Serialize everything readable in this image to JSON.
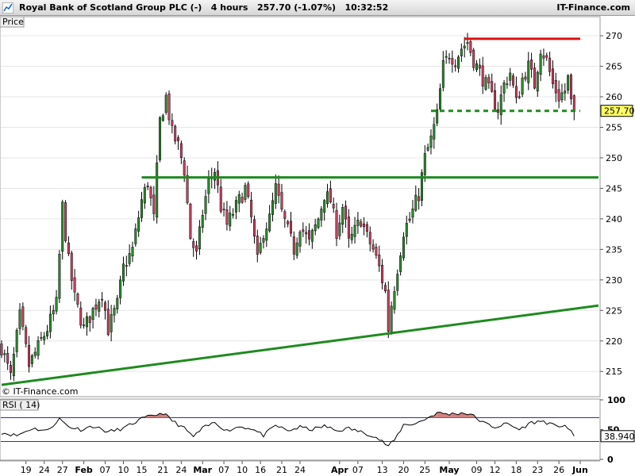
{
  "header": {
    "title": "Royal Bank of Scotland Group PLC (-)   4 hours   257.70 (-1.07%)   10:32:52",
    "brand": "IT-Finance.com"
  },
  "colors": {
    "up": "#2e8b2e",
    "down": "#c94060",
    "support": "#1f8a1f",
    "resistance": "#e01010",
    "rsi_line": "#000000",
    "rsi_levels": "#3030a0",
    "rsi_fill": "#d08080"
  },
  "price_panel": {
    "label": "Price",
    "watermark": "© IT-Finance.com",
    "last_value": "257.70"
  },
  "rsi_panel": {
    "label": "RSI ( 14)",
    "last_value": "38.940"
  },
  "chart_data": [
    {
      "type": "candlestick",
      "ylim": [
        211,
        273
      ],
      "yticks": [
        215,
        220,
        225,
        230,
        235,
        240,
        245,
        250,
        255,
        260,
        265,
        270
      ],
      "x_range": [
        0,
        196
      ],
      "xticks": [
        {
          "label": "19",
          "x": 8,
          "bold": false
        },
        {
          "label": "24",
          "x": 14,
          "bold": false
        },
        {
          "label": "27",
          "x": 20,
          "bold": false
        },
        {
          "label": "Feb",
          "x": 27,
          "bold": true
        },
        {
          "label": "07",
          "x": 34,
          "bold": false
        },
        {
          "label": "10",
          "x": 40,
          "bold": false
        },
        {
          "label": "15",
          "x": 46,
          "bold": false
        },
        {
          "label": "21",
          "x": 53,
          "bold": false
        },
        {
          "label": "24",
          "x": 59,
          "bold": false
        },
        {
          "label": "Mar",
          "x": 66,
          "bold": true
        },
        {
          "label": "07",
          "x": 73,
          "bold": false
        },
        {
          "label": "10",
          "x": 79,
          "bold": false
        },
        {
          "label": "16",
          "x": 85,
          "bold": false
        },
        {
          "label": "21",
          "x": 92,
          "bold": false
        },
        {
          "label": "24",
          "x": 98,
          "bold": false
        },
        {
          "label": "Apr",
          "x": 111,
          "bold": true
        },
        {
          "label": "07",
          "x": 117,
          "bold": false
        },
        {
          "label": "13",
          "x": 125,
          "bold": false
        },
        {
          "label": "20",
          "x": 132,
          "bold": false
        },
        {
          "label": "25",
          "x": 139,
          "bold": false
        },
        {
          "label": "May",
          "x": 147,
          "bold": true
        },
        {
          "label": "09",
          "x": 156,
          "bold": false
        },
        {
          "label": "12",
          "x": 162,
          "bold": false
        },
        {
          "label": "18",
          "x": 169,
          "bold": false
        },
        {
          "label": "23",
          "x": 176,
          "bold": false
        },
        {
          "label": "26",
          "x": 183,
          "bold": false
        },
        {
          "label": "Jun",
          "x": 190,
          "bold": true
        }
      ],
      "key_points": [
        {
          "x": 0,
          "v": 219
        },
        {
          "x": 3,
          "v": 214
        },
        {
          "x": 6,
          "v": 224
        },
        {
          "x": 9,
          "v": 216
        },
        {
          "x": 12,
          "v": 219
        },
        {
          "x": 15,
          "v": 222
        },
        {
          "x": 18,
          "v": 226
        },
        {
          "x": 20,
          "v": 242
        },
        {
          "x": 22,
          "v": 233
        },
        {
          "x": 24,
          "v": 227
        },
        {
          "x": 27,
          "v": 222
        },
        {
          "x": 30,
          "v": 225
        },
        {
          "x": 33,
          "v": 228
        },
        {
          "x": 35,
          "v": 222
        },
        {
          "x": 38,
          "v": 226
        },
        {
          "x": 40,
          "v": 232
        },
        {
          "x": 43,
          "v": 235
        },
        {
          "x": 46,
          "v": 243
        },
        {
          "x": 48,
          "v": 246
        },
        {
          "x": 50,
          "v": 240
        },
        {
          "x": 52,
          "v": 256
        },
        {
          "x": 54,
          "v": 260
        },
        {
          "x": 56,
          "v": 254
        },
        {
          "x": 58,
          "v": 252
        },
        {
          "x": 60,
          "v": 248
        },
        {
          "x": 62,
          "v": 237
        },
        {
          "x": 64,
          "v": 234
        },
        {
          "x": 66,
          "v": 241
        },
        {
          "x": 68,
          "v": 246
        },
        {
          "x": 70,
          "v": 248
        },
        {
          "x": 72,
          "v": 242
        },
        {
          "x": 74,
          "v": 239
        },
        {
          "x": 77,
          "v": 242
        },
        {
          "x": 80,
          "v": 245
        },
        {
          "x": 82,
          "v": 240
        },
        {
          "x": 84,
          "v": 233
        },
        {
          "x": 86,
          "v": 238
        },
        {
          "x": 88,
          "v": 240
        },
        {
          "x": 90,
          "v": 245
        },
        {
          "x": 92,
          "v": 241
        },
        {
          "x": 94,
          "v": 238
        },
        {
          "x": 96,
          "v": 235
        },
        {
          "x": 98,
          "v": 239
        },
        {
          "x": 101,
          "v": 236
        },
        {
          "x": 104,
          "v": 240
        },
        {
          "x": 106,
          "v": 244
        },
        {
          "x": 108,
          "v": 243
        },
        {
          "x": 110,
          "v": 238
        },
        {
          "x": 112,
          "v": 242
        },
        {
          "x": 114,
          "v": 236
        },
        {
          "x": 116,
          "v": 238
        },
        {
          "x": 118,
          "v": 240
        },
        {
          "x": 120,
          "v": 237
        },
        {
          "x": 122,
          "v": 235
        },
        {
          "x": 124,
          "v": 232
        },
        {
          "x": 126,
          "v": 228
        },
        {
          "x": 127,
          "v": 222
        },
        {
          "x": 128,
          "v": 226
        },
        {
          "x": 130,
          "v": 232
        },
        {
          "x": 132,
          "v": 238
        },
        {
          "x": 134,
          "v": 240
        },
        {
          "x": 137,
          "v": 244
        },
        {
          "x": 139,
          "v": 250
        },
        {
          "x": 141,
          "v": 253
        },
        {
          "x": 143,
          "v": 257
        },
        {
          "x": 145,
          "v": 265
        },
        {
          "x": 147,
          "v": 267
        },
        {
          "x": 149,
          "v": 266
        },
        {
          "x": 151,
          "v": 268
        },
        {
          "x": 153,
          "v": 269
        },
        {
          "x": 155,
          "v": 266
        },
        {
          "x": 157,
          "v": 264
        },
        {
          "x": 159,
          "v": 262
        },
        {
          "x": 161,
          "v": 260
        },
        {
          "x": 163,
          "v": 258
        },
        {
          "x": 165,
          "v": 262
        },
        {
          "x": 167,
          "v": 264
        },
        {
          "x": 169,
          "v": 259
        },
        {
          "x": 171,
          "v": 263
        },
        {
          "x": 173,
          "v": 265
        },
        {
          "x": 175,
          "v": 262
        },
        {
          "x": 177,
          "v": 268
        },
        {
          "x": 179,
          "v": 266
        },
        {
          "x": 181,
          "v": 262
        },
        {
          "x": 183,
          "v": 260
        },
        {
          "x": 185,
          "v": 261
        },
        {
          "x": 186,
          "v": 263
        },
        {
          "x": 187,
          "v": 259
        },
        {
          "x": 188,
          "v": 257.7
        }
      ],
      "lines": [
        {
          "name": "resistance",
          "kind": "solid",
          "x1": 152,
          "v1": 269.5,
          "x2": 190,
          "v2": 269.5,
          "color": "#e01010"
        },
        {
          "name": "support-horizontal",
          "kind": "solid",
          "x1": 46,
          "v1": 246.8,
          "x2": 196,
          "v2": 246.8,
          "color": "#1f8a1f"
        },
        {
          "name": "support-dashed",
          "kind": "dashed",
          "x1": 141,
          "v1": 257.7,
          "x2": 190,
          "v2": 257.7,
          "color": "#1f8a1f"
        },
        {
          "name": "trendline",
          "kind": "solid",
          "x1": 0,
          "v1": 212.8,
          "x2": 196,
          "v2": 225.8,
          "color": "#1f8a1f"
        }
      ]
    },
    {
      "type": "line",
      "name": "RSI ( 14)",
      "ylim": [
        0,
        100
      ],
      "yticks": [
        0,
        50,
        100
      ],
      "levels": [
        30,
        70
      ],
      "key_points": [
        {
          "x": 0,
          "v": 45
        },
        {
          "x": 5,
          "v": 40
        },
        {
          "x": 10,
          "v": 52
        },
        {
          "x": 15,
          "v": 48
        },
        {
          "x": 19,
          "v": 68
        },
        {
          "x": 22,
          "v": 55
        },
        {
          "x": 26,
          "v": 50
        },
        {
          "x": 30,
          "v": 56
        },
        {
          "x": 35,
          "v": 46
        },
        {
          "x": 40,
          "v": 52
        },
        {
          "x": 46,
          "v": 68
        },
        {
          "x": 50,
          "v": 74
        },
        {
          "x": 53,
          "v": 78
        },
        {
          "x": 56,
          "v": 65
        },
        {
          "x": 60,
          "v": 52
        },
        {
          "x": 63,
          "v": 38
        },
        {
          "x": 66,
          "v": 52
        },
        {
          "x": 70,
          "v": 62
        },
        {
          "x": 74,
          "v": 48
        },
        {
          "x": 78,
          "v": 55
        },
        {
          "x": 82,
          "v": 52
        },
        {
          "x": 86,
          "v": 40
        },
        {
          "x": 90,
          "v": 57
        },
        {
          "x": 94,
          "v": 48
        },
        {
          "x": 98,
          "v": 54
        },
        {
          "x": 102,
          "v": 50
        },
        {
          "x": 106,
          "v": 56
        },
        {
          "x": 110,
          "v": 48
        },
        {
          "x": 114,
          "v": 52
        },
        {
          "x": 118,
          "v": 46
        },
        {
          "x": 122,
          "v": 40
        },
        {
          "x": 125,
          "v": 30
        },
        {
          "x": 127,
          "v": 22
        },
        {
          "x": 129,
          "v": 32
        },
        {
          "x": 132,
          "v": 58
        },
        {
          "x": 136,
          "v": 60
        },
        {
          "x": 140,
          "v": 70
        },
        {
          "x": 143,
          "v": 78
        },
        {
          "x": 147,
          "v": 76
        },
        {
          "x": 151,
          "v": 78
        },
        {
          "x": 154,
          "v": 76
        },
        {
          "x": 158,
          "v": 62
        },
        {
          "x": 162,
          "v": 54
        },
        {
          "x": 166,
          "v": 60
        },
        {
          "x": 170,
          "v": 50
        },
        {
          "x": 174,
          "v": 62
        },
        {
          "x": 178,
          "v": 64
        },
        {
          "x": 182,
          "v": 55
        },
        {
          "x": 185,
          "v": 58
        },
        {
          "x": 188,
          "v": 38.94
        }
      ]
    }
  ]
}
